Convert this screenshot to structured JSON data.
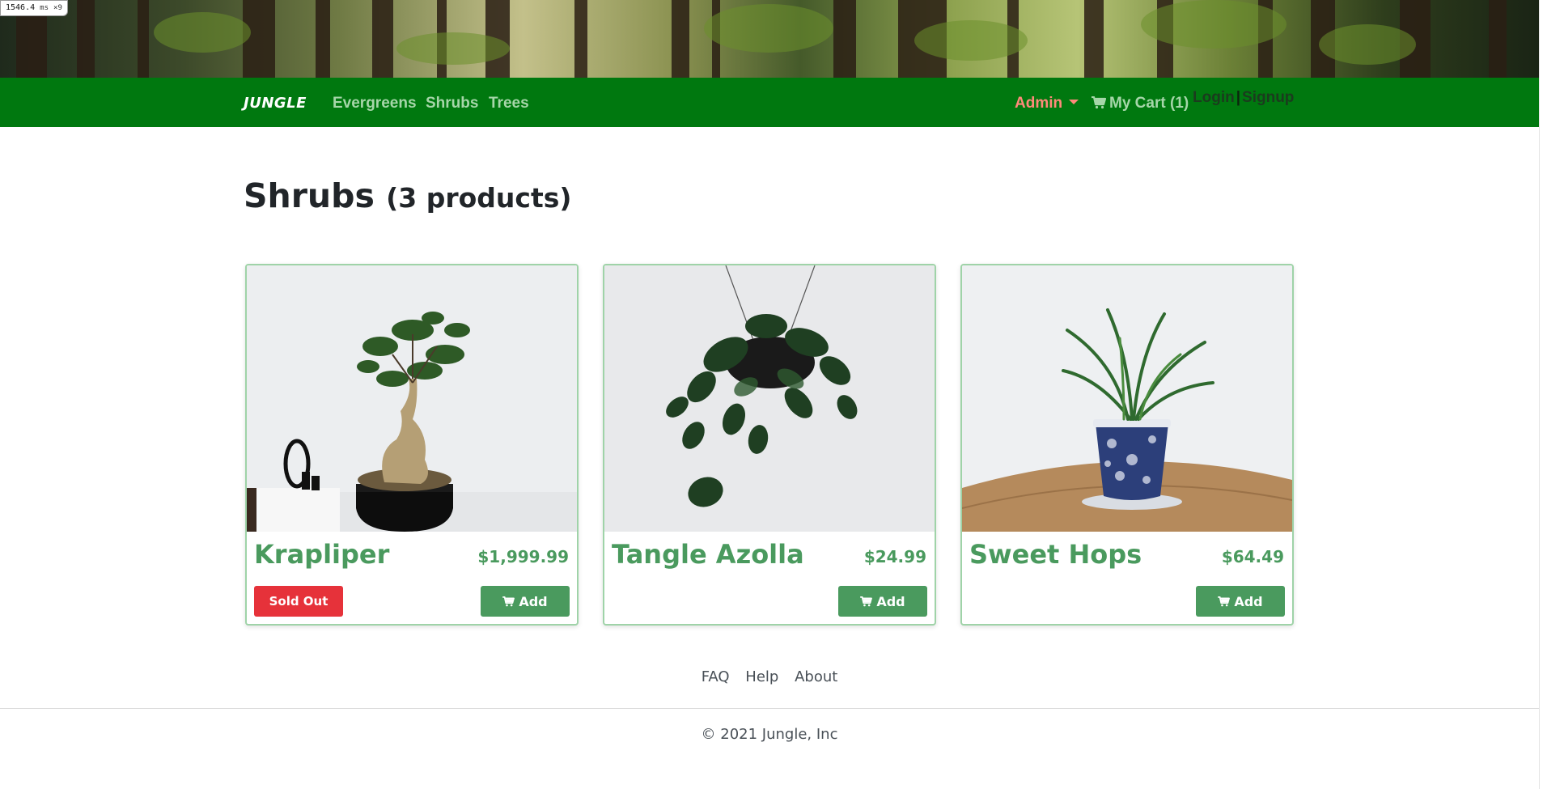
{
  "timer": {
    "value": "1546.4",
    "unit": "ms",
    "multiplier": "×9"
  },
  "navbar": {
    "brand": "JUNGLE",
    "links": [
      "Evergreens",
      "Shrubs",
      "Trees"
    ],
    "admin_label": "Admin",
    "cart_label": "My Cart (1)",
    "login_label": "Login",
    "separator": "|",
    "signup_label": "Signup"
  },
  "page": {
    "title": "Shrubs",
    "count": "(3 products)"
  },
  "products": [
    {
      "name": "Krapliper",
      "price": "$1,999.99",
      "sold_out_label": "Sold Out",
      "add_label": "Add"
    },
    {
      "name": "Tangle Azolla",
      "price": "$24.99",
      "add_label": "Add"
    },
    {
      "name": "Sweet Hops",
      "price": "$64.49",
      "add_label": "Add"
    }
  ],
  "footer": {
    "links": [
      "FAQ",
      "Help",
      "About"
    ],
    "copyright": "© 2021 Jungle, Inc"
  },
  "colors": {
    "navbar": "#00780f",
    "nav_link": "#a6d6a9",
    "admin": "#ff8a7a",
    "product_green": "#4a9a5e",
    "sold_out": "#e6323a"
  },
  "icons": [
    "cart-icon",
    "caret-down-icon"
  ]
}
